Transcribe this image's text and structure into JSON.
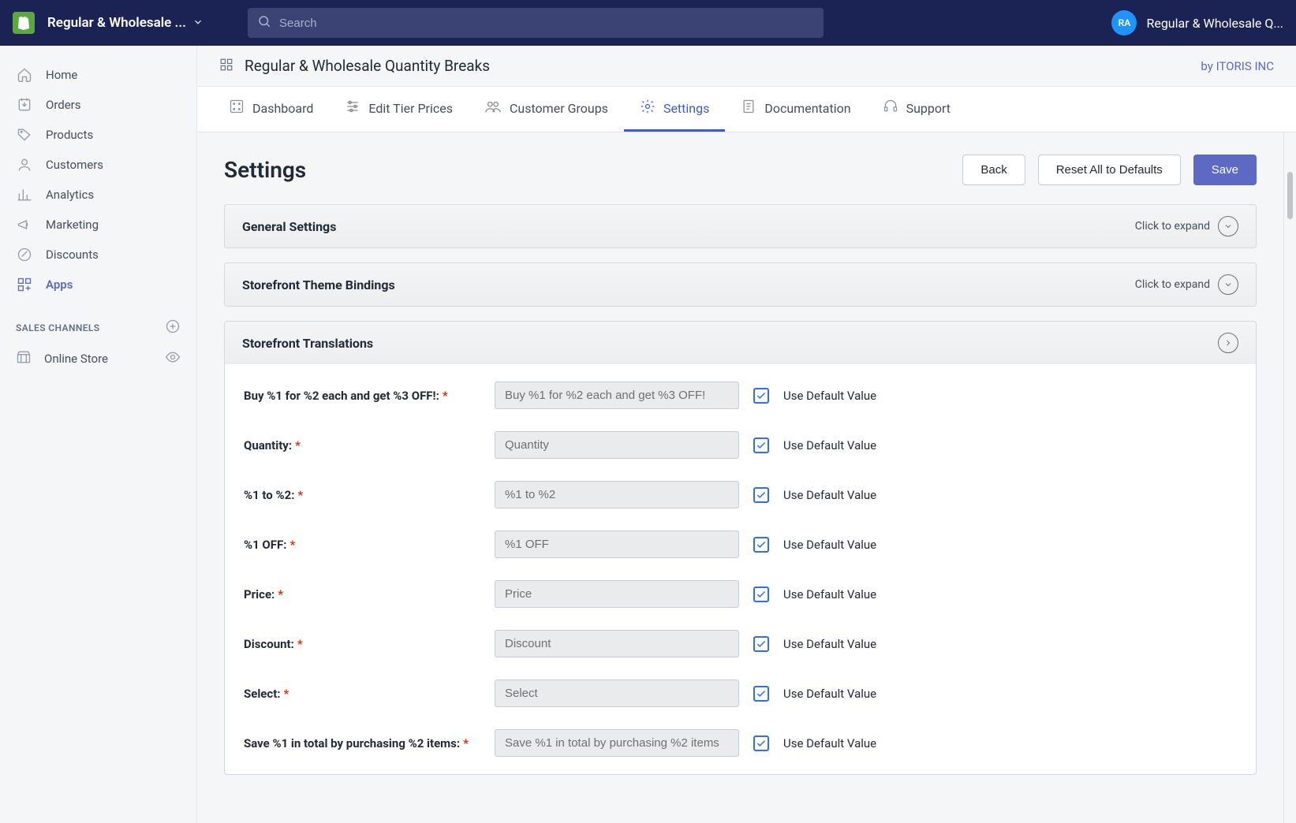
{
  "topbar": {
    "store_name": "Regular & Wholesale ...",
    "search_placeholder": "Search",
    "avatar_initials": "RA",
    "user_label": "Regular & Wholesale Q..."
  },
  "sidebar": {
    "items": [
      {
        "label": "Home"
      },
      {
        "label": "Orders"
      },
      {
        "label": "Products"
      },
      {
        "label": "Customers"
      },
      {
        "label": "Analytics"
      },
      {
        "label": "Marketing"
      },
      {
        "label": "Discounts"
      },
      {
        "label": "Apps"
      }
    ],
    "section_header": "SALES CHANNELS",
    "channels": [
      {
        "label": "Online Store"
      }
    ]
  },
  "app_header": {
    "title": "Regular & Wholesale Quantity Breaks",
    "by": "by ITORIS INC"
  },
  "tabs": [
    {
      "label": "Dashboard"
    },
    {
      "label": "Edit Tier Prices"
    },
    {
      "label": "Customer Groups"
    },
    {
      "label": "Settings"
    },
    {
      "label": "Documentation"
    },
    {
      "label": "Support"
    }
  ],
  "page": {
    "title": "Settings",
    "btn_back": "Back",
    "btn_reset": "Reset All to Defaults",
    "btn_save": "Save"
  },
  "panels": {
    "general": {
      "title": "General Settings",
      "hint": "Click to expand"
    },
    "bindings": {
      "title": "Storefront Theme Bindings",
      "hint": "Click to expand"
    },
    "translations": {
      "title": "Storefront Translations"
    }
  },
  "translations": [
    {
      "label": "Buy %1 for %2 each and get %3 OFF!:",
      "value": "Buy %1 for %2 each and get %3 OFF!",
      "use_default": "Use Default Value"
    },
    {
      "label": "Quantity:",
      "value": "Quantity",
      "use_default": "Use Default Value"
    },
    {
      "label": "%1 to %2:",
      "value": "%1 to %2",
      "use_default": "Use Default Value"
    },
    {
      "label": "%1 OFF:",
      "value": "%1 OFF",
      "use_default": "Use Default Value"
    },
    {
      "label": "Price:",
      "value": "Price",
      "use_default": "Use Default Value"
    },
    {
      "label": "Discount:",
      "value": "Discount",
      "use_default": "Use Default Value"
    },
    {
      "label": "Select:",
      "value": "Select",
      "use_default": "Use Default Value"
    },
    {
      "label": "Save %1 in total by purchasing %2 items:",
      "value": "Save %1 in total by purchasing %2 items",
      "use_default": "Use Default Value"
    }
  ]
}
